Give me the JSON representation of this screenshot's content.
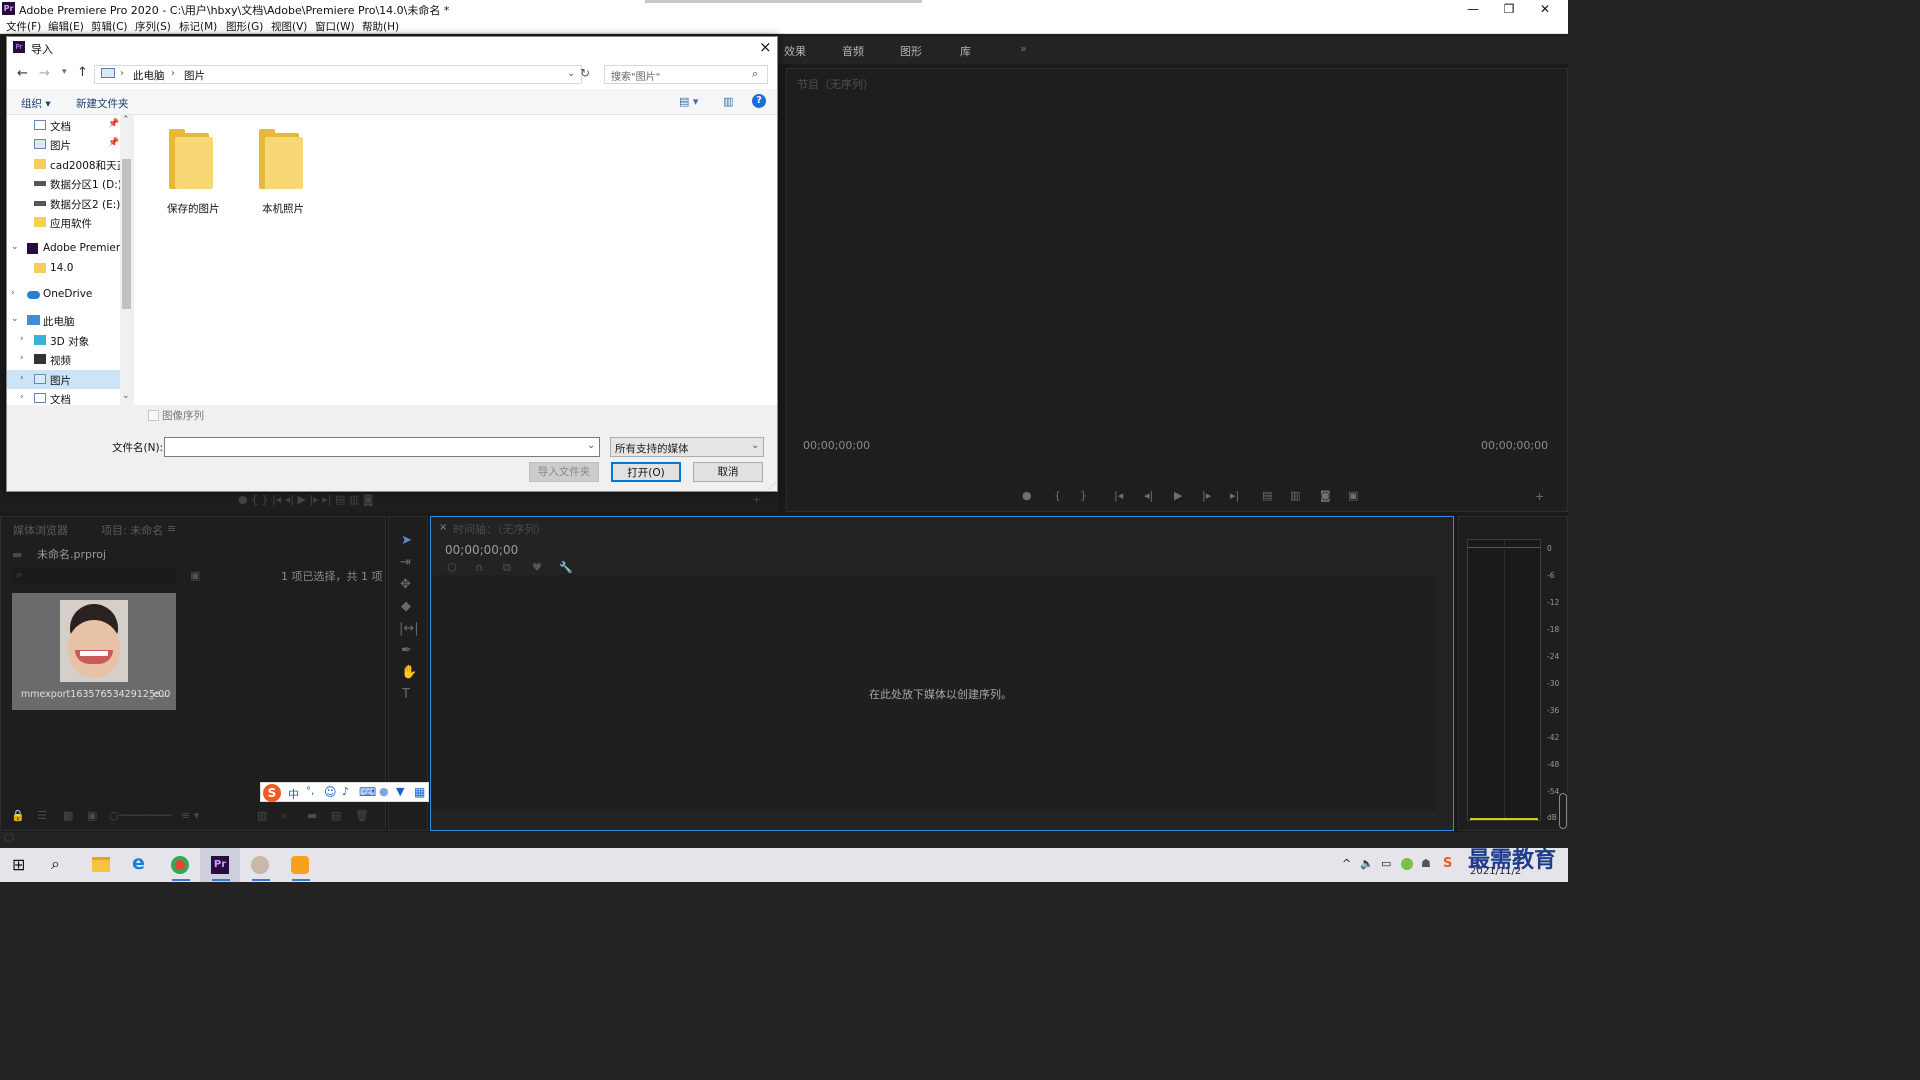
{
  "window": {
    "title": "Adobe Premiere Pro 2020 - C:\\用户\\hbxy\\文档\\Adobe\\Premiere Pro\\14.0\\未命名 *",
    "app_icon": "Pr",
    "minimize": "—",
    "restore": "❐",
    "close": "✕"
  },
  "menu": [
    "文件(F)",
    "编辑(E)",
    "剪辑(C)",
    "序列(S)",
    "标记(M)",
    "图形(G)",
    "视图(V)",
    "窗口(W)",
    "帮助(H)"
  ],
  "top_tabs": [
    "效果",
    "音频",
    "图形",
    "库"
  ],
  "program_monitor": {
    "title": "节目（无序列）",
    "timecode_left": "00;00;00;00",
    "timecode_right": "00;00;00;00"
  },
  "project_panel": {
    "tabs": [
      "媒体浏览器",
      "项目: 未命名"
    ],
    "project_file": "未命名.prproj",
    "selection_status": "1 项已选择，共 1 项",
    "clip_name": "mmexport1635765342912_e...",
    "clip_duration": "5:00"
  },
  "timeline": {
    "title": "时间轴：（无序列）",
    "timecode": "00;00;00;00",
    "empty_message": "在此处放下媒体以创建序列。"
  },
  "audio_meter": {
    "labels": [
      "0",
      "-6",
      "-12",
      "-18",
      "-24",
      "-30",
      "-36",
      "-42",
      "-48",
      "-54",
      "dB"
    ]
  },
  "dialog": {
    "title": "导入",
    "breadcrumb": [
      "此电脑",
      "图片"
    ],
    "search_placeholder": "搜索\"图片\"",
    "toolbar": {
      "organize": "组织 ▾",
      "new_folder": "新建文件夹"
    },
    "nav_tree": [
      {
        "label": "文档",
        "pinned": true
      },
      {
        "label": "图片",
        "pinned": true
      },
      {
        "label": "cad2008和天正"
      },
      {
        "label": "数据分区1 (D:)"
      },
      {
        "label": "数据分区2 (E:)"
      },
      {
        "label": "应用软件"
      },
      {
        "label": "Adobe Premiere"
      },
      {
        "label": "14.0"
      },
      {
        "label": "OneDrive"
      },
      {
        "label": "此电脑"
      },
      {
        "label": "3D 对象"
      },
      {
        "label": "视频"
      },
      {
        "label": "图片"
      },
      {
        "label": "文档"
      }
    ],
    "folders": [
      "保存的图片",
      "本机照片"
    ],
    "image_sequence_label": "图像序列",
    "filename_label": "文件名(N):",
    "filename_value": "",
    "filetype": "所有支持的媒体",
    "import_folder_button": "导入文件夹",
    "open_button": "打开(O)",
    "cancel_button": "取消"
  },
  "ime_toolbar": [
    "中",
    "°,",
    "☺",
    "🎤",
    "⌨",
    "👤",
    "👕",
    "▦"
  ],
  "taskbar": {
    "date": "2021/11/2",
    "watermark": "最需教育"
  }
}
